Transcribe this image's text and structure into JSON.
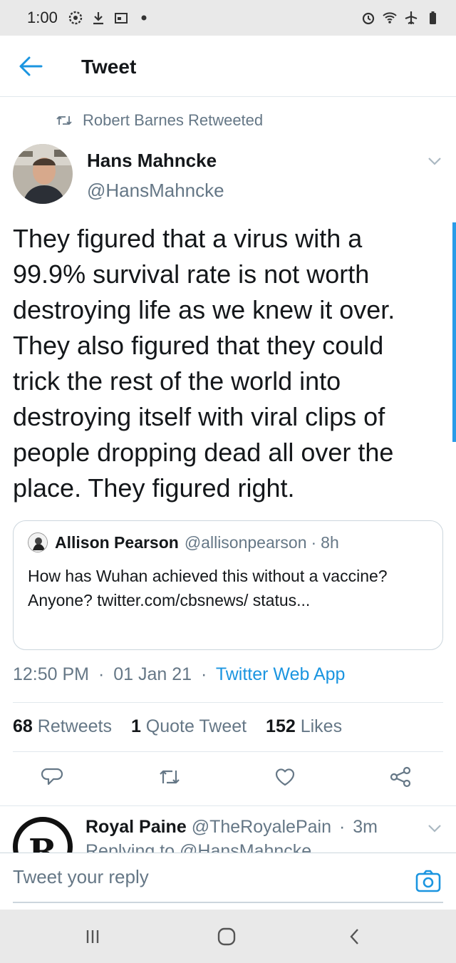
{
  "status_bar": {
    "time": "1:00"
  },
  "header": {
    "title": "Tweet"
  },
  "retweet_context": {
    "text": "Robert Barnes Retweeted"
  },
  "tweet": {
    "author_name": "Hans Mahncke",
    "author_handle": "@HansMahncke",
    "text": "They figured that a virus with a\n99.9% survival rate is not worth\ndestroying life as we knew it over.\nThey also figured that they could\ntrick the rest of the world into\ndestroying itself with viral clips of\npeople dropping dead all over the\nplace. They figured right.",
    "time": "12:50 PM",
    "date": "01 Jan 21",
    "source": "Twitter Web App",
    "separator": "·"
  },
  "quoted_tweet": {
    "author_name": "Allison Pearson",
    "author_handle": "@allisonpearson",
    "age": "8h",
    "text": "How has Wuhan achieved this without a vaccine? Anyone? twitter.com/cbsnews/ status..."
  },
  "stats": {
    "retweets_count": "68",
    "retweets_label": "Retweets",
    "quotes_count": "1",
    "quotes_label": "Quote Tweet",
    "likes_count": "152",
    "likes_label": "Likes"
  },
  "reply_preview": {
    "author_name": "Royal Paine",
    "author_handle": "@TheRoyalePain",
    "age": "3m",
    "replying_to": "Replying to @HansMahncke"
  },
  "compose": {
    "placeholder": "Tweet your reply"
  },
  "colors": {
    "accent": "#1b95e0",
    "text": "#14171a",
    "secondary": "#657786",
    "border": "#e1e8ed"
  },
  "icons": [
    "back-arrow-icon",
    "retweet-icon",
    "chevron-down-icon",
    "reply-icon",
    "like-icon",
    "share-icon",
    "camera-icon",
    "recent-apps-icon",
    "home-icon",
    "back-icon"
  ]
}
